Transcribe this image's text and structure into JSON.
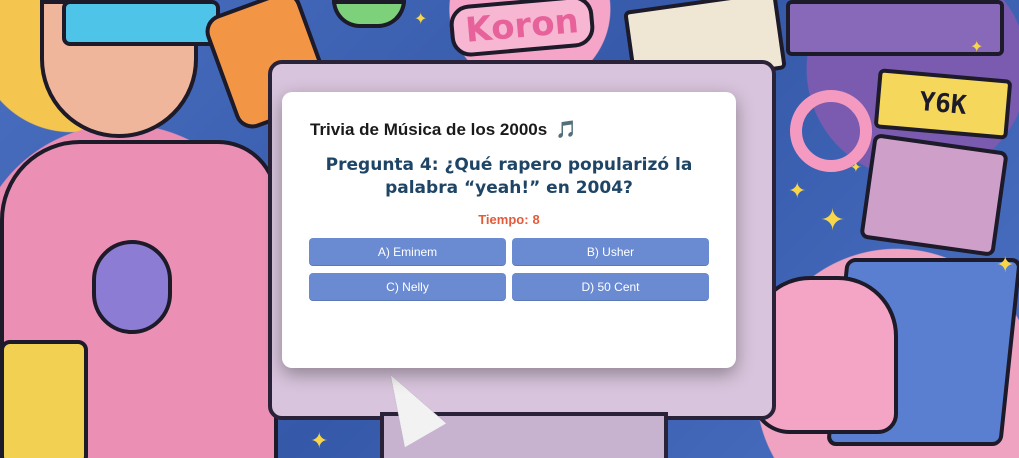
{
  "background": {
    "sticker_text": "Koron",
    "plate_text": "Y6K"
  },
  "quiz": {
    "title": "Trivia de Música de los 2000s",
    "title_icon": "🎵",
    "question": "Pregunta 4: ¿Qué rapero popularizó la palabra “yeah!” en 2004?",
    "timer_label": "Tiempo:",
    "timer_value": "8",
    "answers": [
      {
        "label": "A) Eminem"
      },
      {
        "label": "B) Usher"
      },
      {
        "label": "C) Nelly"
      },
      {
        "label": "D) 50 Cent"
      }
    ]
  },
  "colors": {
    "answer_button": "#6a8ad2",
    "question_text": "#1f4566",
    "timer_text": "#e25b3a",
    "background_blue": "#3d62b4"
  }
}
